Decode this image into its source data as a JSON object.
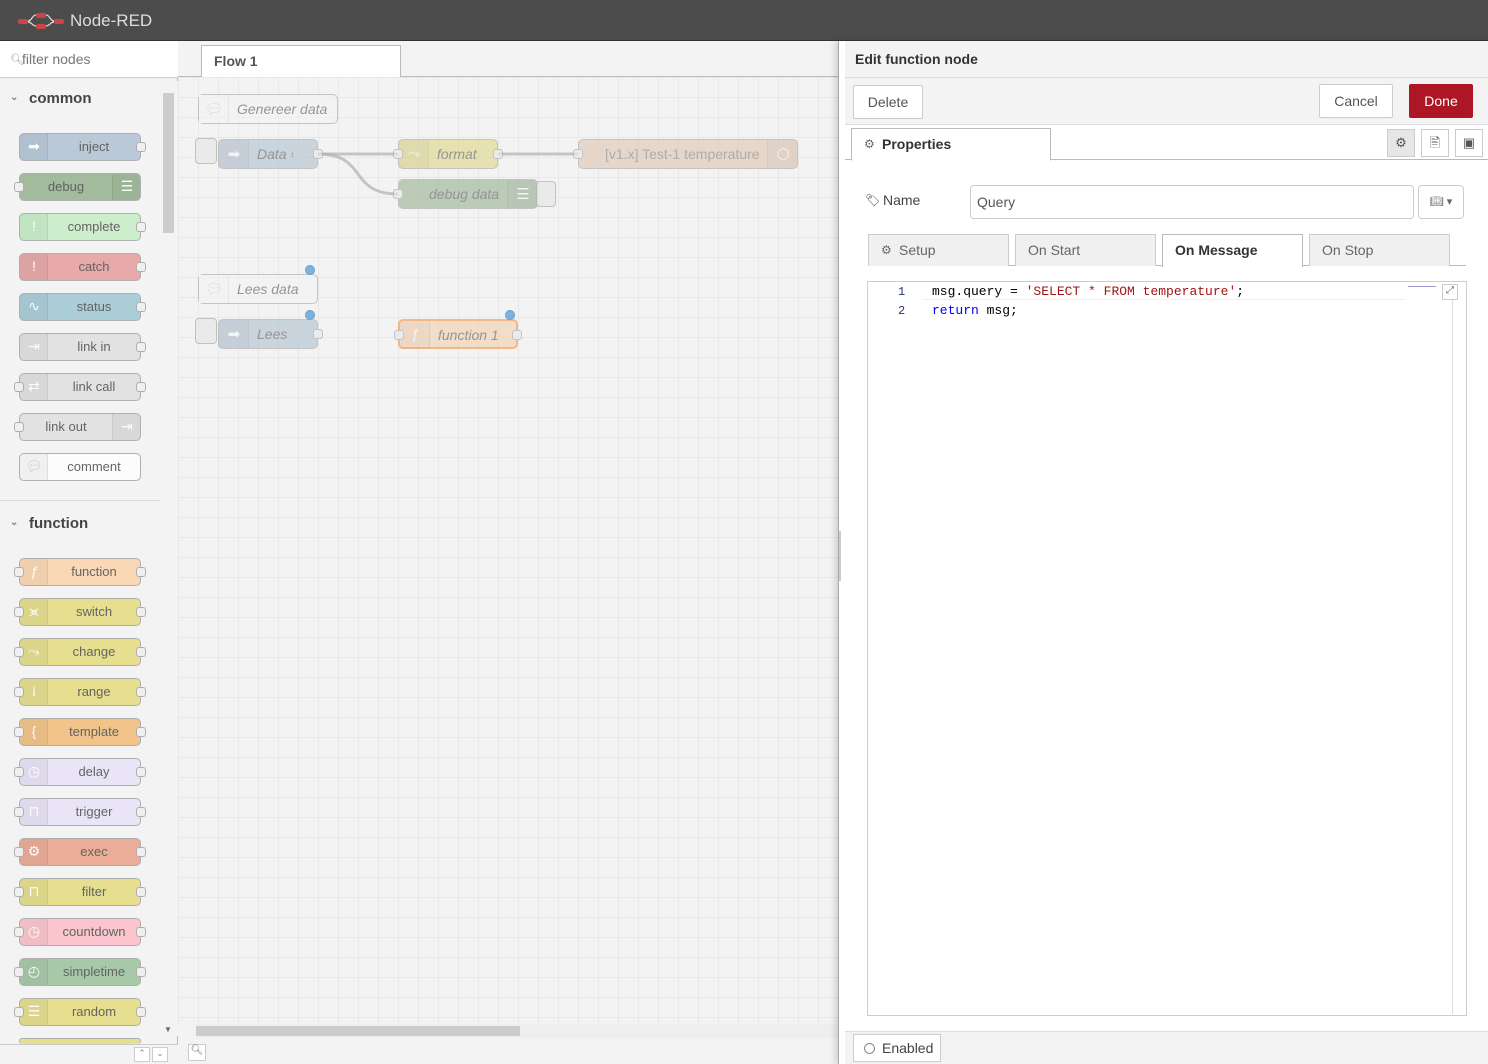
{
  "header": {
    "brand": "Node-RED"
  },
  "palette": {
    "search_placeholder": "filter nodes",
    "categories": [
      {
        "label": "common",
        "nodes": [
          "inject",
          "debug",
          "complete",
          "catch",
          "status",
          "link in",
          "link call",
          "link out",
          "comment"
        ]
      },
      {
        "label": "function",
        "nodes": [
          "function",
          "switch",
          "change",
          "range",
          "template",
          "delay",
          "trigger",
          "exec",
          "filter",
          "countdown",
          "simpletime",
          "random"
        ]
      }
    ]
  },
  "workspace": {
    "tab_label": "Flow 1",
    "nodes": {
      "comment1": "Genereer data",
      "inject1": "Data",
      "inject1_suffix": "¹",
      "change1": "format",
      "influx1": "[v1.x] Test-1 temperature",
      "debug1": "debug data",
      "comment2": "Lees data",
      "inject2": "Lees",
      "function1": "function 1"
    }
  },
  "tray": {
    "title": "Edit function node",
    "delete_label": "Delete",
    "cancel_label": "Cancel",
    "done_label": "Done",
    "properties_tab": "Properties",
    "name_label": "Name",
    "name_value": "Query",
    "fn_tabs": {
      "setup": "Setup",
      "on_start": "On Start",
      "on_message": "On Message",
      "on_stop": "On Stop"
    },
    "editor": {
      "line1_num": "1",
      "line1_a": "msg.query = ",
      "line1_str": "'SELECT * FROM temperature'",
      "line1_b": ";",
      "line2_num": "2",
      "line2_kw": "return",
      "line2_b": " msg;"
    },
    "enabled_label": "Enabled"
  },
  "colors": {
    "header_bg": "#4c4c4c",
    "done_bg": "#ad1625",
    "inject": "#a6bbcf",
    "debug": "#87a980",
    "complete": "#c0edc0",
    "catch": "#e49191",
    "status": "#94c1d0",
    "link": "#dddddd",
    "function": "#fdd0a2",
    "switch": "#e2d96e",
    "range": "#e2d96e",
    "template": "#f3b567",
    "delay": "#e6e0f8",
    "trigger": "#e6e0f8",
    "exec": "#e9967a",
    "filter": "#e2d96e",
    "countdown": "#ffb6c1",
    "simpletime": "#8fbc8f",
    "random": "#e2d96e",
    "influx": "#e6c3a9"
  }
}
